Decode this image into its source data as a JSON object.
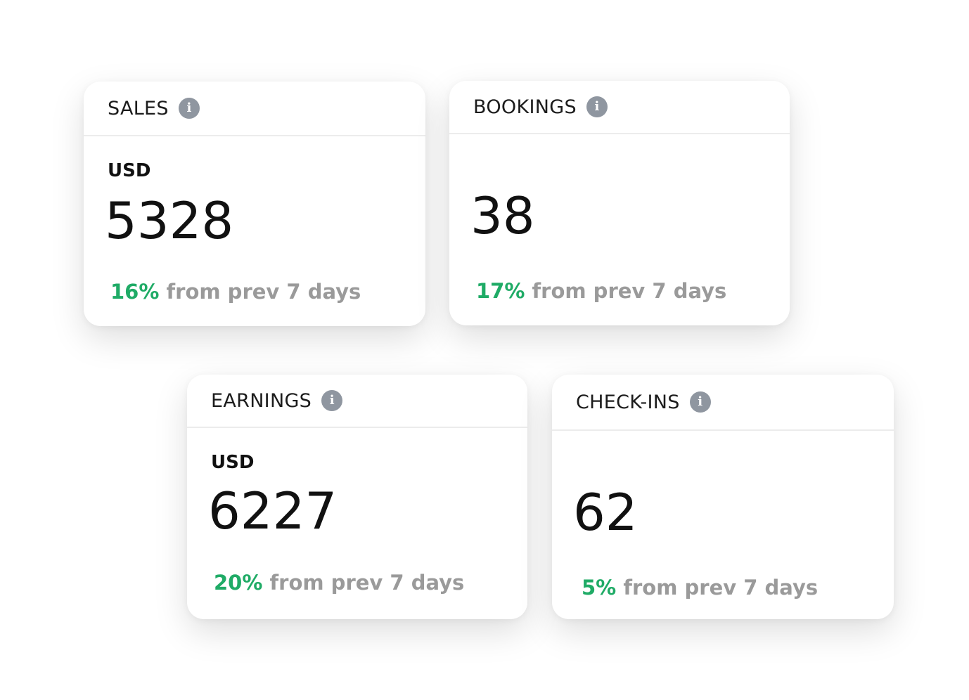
{
  "cards": [
    {
      "title": "SALES",
      "currency": "USD",
      "value": "5328",
      "change_pct": "16%",
      "change_text": "from prev 7 days"
    },
    {
      "title": "BOOKINGS",
      "value": "38",
      "change_pct": "17%",
      "change_text": "from prev 7 days"
    },
    {
      "title": "EARNINGS",
      "currency": "USD",
      "value": "6227",
      "change_pct": "20%",
      "change_text": "from prev 7 days"
    },
    {
      "title": "CHECK-INS",
      "value": "62",
      "change_pct": "5%",
      "change_text": "from prev 7 days"
    }
  ],
  "icons": {
    "info": "i"
  },
  "colors": {
    "positive": "#1fab66",
    "muted": "#9a9a9a",
    "icon": "#8f96a0"
  }
}
